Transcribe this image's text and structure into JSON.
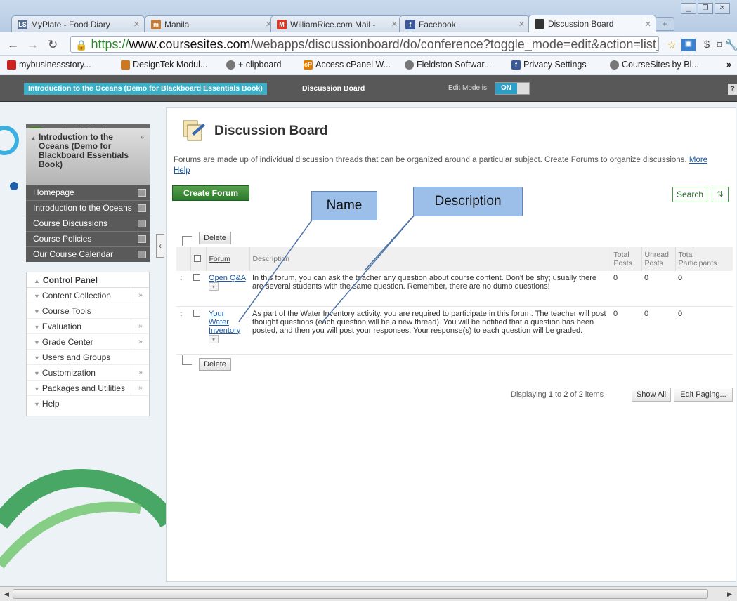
{
  "browser": {
    "tabs": [
      {
        "label": "MyPlate - Food Diary",
        "icon": "LS"
      },
      {
        "label": "Manila",
        "icon": "m"
      },
      {
        "label": "WilliamRice.com Mail -",
        "icon": "M"
      },
      {
        "label": "Facebook",
        "icon": "f"
      },
      {
        "label": "Discussion Board",
        "icon": "db"
      }
    ],
    "url": {
      "scheme": "https://",
      "host": "www.coursesites.com",
      "path": "/webapps/discussionboard/do/conference?toggle_mode=edit&action=list_"
    },
    "bookmarks": [
      {
        "label": "mybusinessstory...",
        "color": "#cc2222"
      },
      {
        "label": "DesignTek Modul...",
        "color": "#cc7722"
      },
      {
        "label": "+ clipboard",
        "color": "#777777"
      },
      {
        "label": "Access cPanel W...",
        "color": "#e07b00"
      },
      {
        "label": "Fieldston Softwar...",
        "color": "#777777"
      },
      {
        "label": "Privacy Settings",
        "color": "#3b5998"
      },
      {
        "label": "CourseSites by Bl...",
        "color": "#777777"
      }
    ],
    "overflow_glyph": "»"
  },
  "bb_bar": {
    "course_crumb": "Introduction to the Oceans (Demo for Blackboard Essentials Book)",
    "page_crumb": "Discussion Board",
    "edit_mode_label": "Edit Mode is:",
    "edit_mode_value": "ON",
    "help": "?"
  },
  "course_menu": {
    "course_title": "Introduction to the Oceans (Demo for Blackboard Essentials Book)",
    "items": [
      "Homepage",
      "Introduction to the Oceans",
      "Course Discussions",
      "Course Policies",
      "Our Course Calendar"
    ]
  },
  "control_panel": {
    "title": "Control Panel",
    "items": [
      {
        "label": "Content Collection",
        "more": true
      },
      {
        "label": "Course Tools",
        "more": false
      },
      {
        "label": "Evaluation",
        "more": true
      },
      {
        "label": "Grade Center",
        "more": true
      },
      {
        "label": "Users and Groups",
        "more": false
      },
      {
        "label": "Customization",
        "more": true
      },
      {
        "label": "Packages and Utilities",
        "more": true
      },
      {
        "label": "Help",
        "more": false
      }
    ]
  },
  "main": {
    "title": "Discussion Board",
    "intro": "Forums are made up of individual discussion threads that can be organized around a particular subject. Create Forums to organize discussions.",
    "more_help": "More Help",
    "create_forum": "Create Forum",
    "search": "Search",
    "delete": "Delete",
    "columns": {
      "forum": "Forum",
      "description": "Description",
      "total_posts": "Total Posts",
      "unread_posts": "Unread Posts",
      "total_participants": "Total Participants"
    },
    "forums": [
      {
        "name": "Open Q&A",
        "description": "In this forum, you can ask the teacher any question about course content. Don't be shy; usually there are several students with the same question. Remember, there are no dumb questions!",
        "total_posts": "0",
        "unread_posts": "0",
        "total_participants": "0"
      },
      {
        "name": "Your Water Inventory",
        "description": "As part of the Water Inventory activity, you are required to participate in this forum. The teacher will post thought questions (each question will be a new thread). You will be notified that a question has been posted, and then you will post your responses. Your response(s) to each question will be graded.",
        "total_posts": "0",
        "unread_posts": "0",
        "total_participants": "0"
      }
    ],
    "paging": {
      "prefix": "Displaying",
      "from": "1",
      "to_word": "to",
      "to": "2",
      "of_word": "of",
      "total": "2",
      "suffix": "items",
      "show_all": "Show All",
      "edit_paging": "Edit Paging..."
    }
  },
  "callouts": {
    "name": "Name",
    "description": "Description"
  },
  "colors": {
    "accent_green": "#2c7a2c",
    "crumb_blue": "#3aafc6",
    "callout_fill": "#9cbfe9"
  }
}
